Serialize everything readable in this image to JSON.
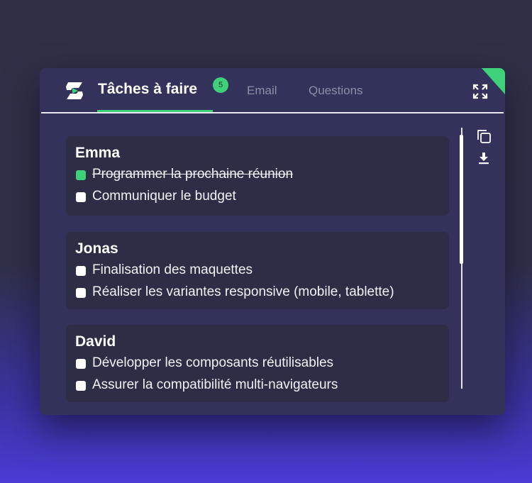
{
  "header": {
    "tabs": [
      {
        "label": "Tâches à faire",
        "badge": "5",
        "active": true
      },
      {
        "label": "Email",
        "active": false
      },
      {
        "label": "Questions",
        "active": false
      }
    ]
  },
  "cards": [
    {
      "name": "Emma",
      "tasks": [
        {
          "text": "Programmer la prochaine réunion",
          "done": true
        },
        {
          "text": "Communiquer le budget",
          "done": false
        }
      ]
    },
    {
      "name": "Jonas",
      "tasks": [
        {
          "text": "Finalisation des maquettes",
          "done": false
        },
        {
          "text": "Réaliser les variantes responsive (mobile, tablette)",
          "done": false
        }
      ]
    },
    {
      "name": "David",
      "tasks": [
        {
          "text": "Développer les composants réutilisables",
          "done": false
        },
        {
          "text": "Assurer la compatibilité multi-navigateurs",
          "done": false
        }
      ]
    }
  ],
  "colors": {
    "accent": "#3fd07a",
    "panel": "#33325a",
    "card": "#2d2d46",
    "text": "#ffffff",
    "muted_tab": "#8d8ea8"
  },
  "icons": {
    "logo": "brand-logo-icon",
    "expand": "expand-icon",
    "copy": "copy-icon",
    "download": "download-icon"
  }
}
